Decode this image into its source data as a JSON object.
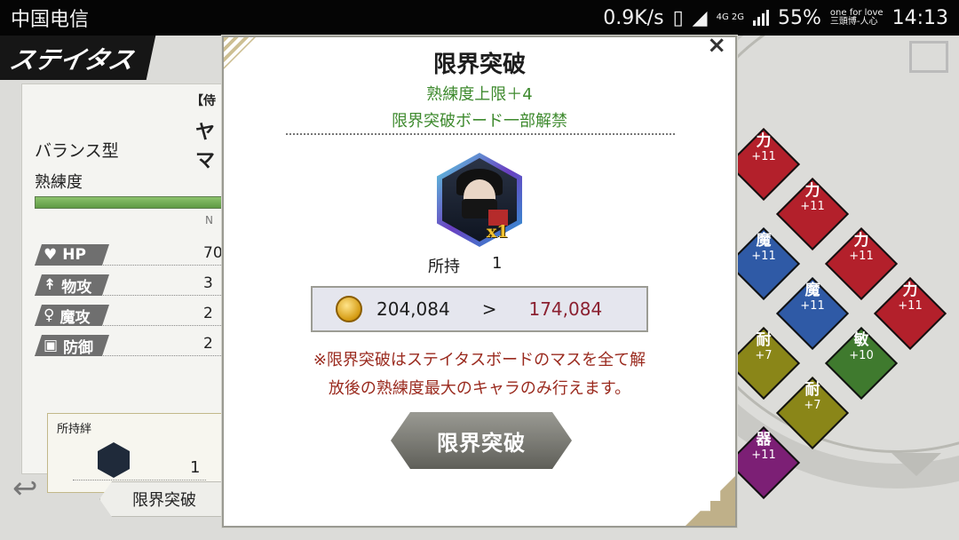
{
  "status_bar": {
    "carrier": "中国电信",
    "net_speed": "0.9K/s",
    "network": "4G 2G",
    "battery": "55%",
    "extra_top": "one for love",
    "extra_bottom": "三頭博-人心",
    "time": "14:13"
  },
  "background": {
    "screen_title": "ステイタス",
    "character_tag": "【侍",
    "character_name": "ヤマ",
    "type": "バランス型",
    "proficiency_label": "熟練度",
    "proficiency_marker": "N",
    "stats": [
      {
        "icon": "heart-icon",
        "label": "HP",
        "value": "70"
      },
      {
        "icon": "sword-icon",
        "label": "物攻",
        "value": "3"
      },
      {
        "icon": "staff-icon",
        "label": "魔攻",
        "value": "2"
      },
      {
        "icon": "shield-icon",
        "label": "防御",
        "value": "2"
      }
    ],
    "kizuna_label": "所持絆",
    "kizuna_count": "1",
    "back_button": "限界突破",
    "board_tiles": [
      {
        "kanji": "力",
        "bonus": "+11",
        "color": "#b3202b"
      },
      {
        "kanji": "力",
        "bonus": "+11",
        "color": "#b3202b"
      },
      {
        "kanji": "魔",
        "bonus": "+11",
        "color": "#2f5aa6"
      },
      {
        "kanji": "力",
        "bonus": "+11",
        "color": "#b3202b"
      },
      {
        "kanji": "魔",
        "bonus": "+11",
        "color": "#2f5aa6"
      },
      {
        "kanji": "力",
        "bonus": "+11",
        "color": "#b3202b"
      },
      {
        "kanji": "耐",
        "bonus": "+7",
        "color": "#8a8618"
      },
      {
        "kanji": "敏",
        "bonus": "+10",
        "color": "#3f7a2e"
      },
      {
        "kanji": "耐",
        "bonus": "+7",
        "color": "#8a8618"
      },
      {
        "kanji": "器",
        "bonus": "+11",
        "color": "#7c1f75"
      }
    ]
  },
  "modal": {
    "title": "限界突破",
    "effect_1": "熟練度上限＋4",
    "effect_2": "限界突破ボード一部解禁",
    "item_quantity": "x1",
    "owned_label": "所持",
    "owned_value": "1",
    "coins_current": "204,084",
    "coins_arrow": ">",
    "coins_after": "174,084",
    "notice_line_1": "※限界突破はステイタスボードのマスを全て解",
    "notice_line_2": "放後の熟練度最大のキャラのみ行えます。",
    "confirm_button": "限界突破",
    "close_symbol": "×"
  }
}
